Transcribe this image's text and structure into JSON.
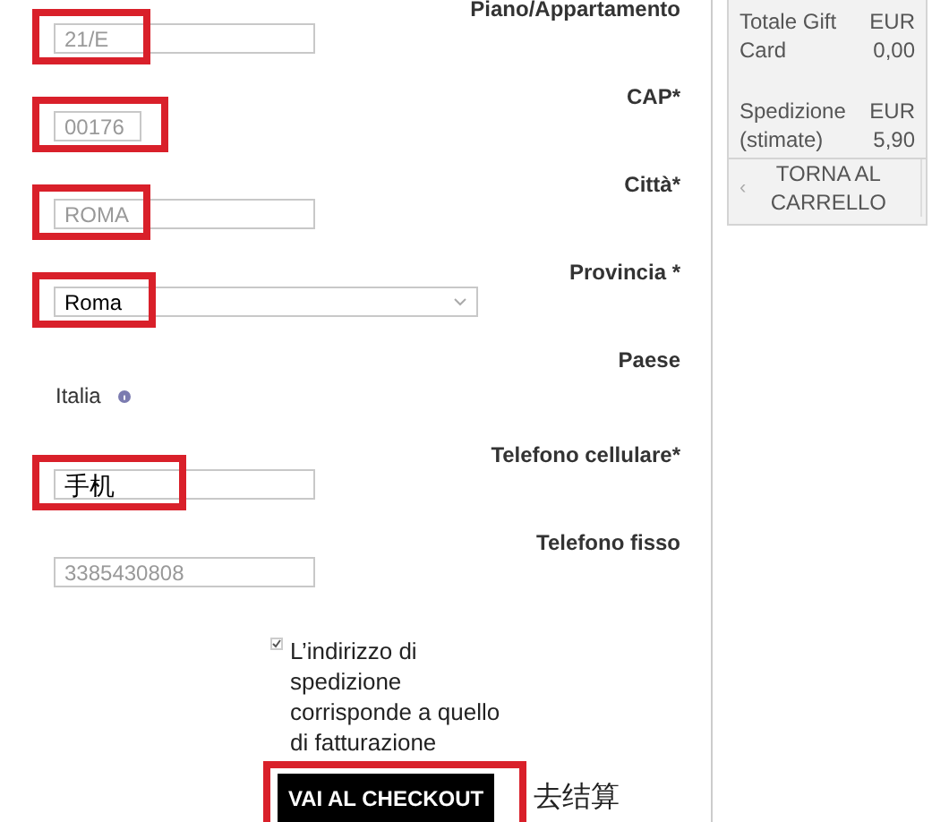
{
  "fields": [
    {
      "label": "Piano/Appartamento",
      "kind": "text",
      "value": "21/E",
      "highlighted": true
    },
    {
      "label": "CAP*",
      "kind": "short",
      "value": "00176",
      "highlighted": true
    },
    {
      "label": "Città*",
      "kind": "text",
      "value": "ROMA",
      "highlighted": true
    },
    {
      "label": "Provincia *",
      "kind": "select",
      "value": "Roma",
      "highlighted": true
    },
    {
      "label": "Paese",
      "kind": "static",
      "value": "Italia",
      "highlighted": false
    },
    {
      "label": "Telefono cellulare*",
      "kind": "text",
      "value": "手机",
      "highlighted": true
    },
    {
      "label": "Telefono fisso",
      "kind": "text",
      "value": "3385430808",
      "highlighted": false
    }
  ],
  "same_address": {
    "label": "L’indirizzo di spedizione corrisponde a quello di fatturazione",
    "checked": true
  },
  "checkout_button": {
    "label": "VAI AL CHECKOUT",
    "highlighted": true
  },
  "checkout_note": "去结算",
  "summary": {
    "rows": [
      {
        "label": "Totale Gift Card",
        "value": "EUR 0,00"
      },
      {
        "label": "Spedizione (stimate)",
        "value": "EUR 5,90"
      }
    ],
    "back_button": {
      "icon": "‹",
      "label": "TORNA AL CARRELLO"
    }
  }
}
